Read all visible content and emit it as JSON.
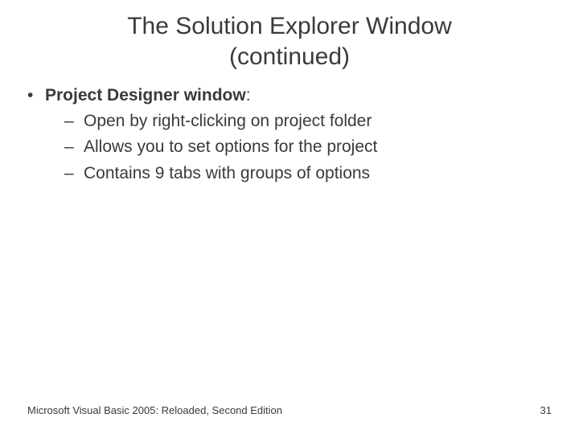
{
  "title_line1": "The Solution Explorer Window",
  "title_line2": "(continued)",
  "bullets": {
    "lead": "Project Designer window",
    "lead_suffix": ":",
    "items": [
      "Open by right-clicking on project folder",
      "Allows you to set options for the project",
      "Contains 9 tabs with groups of options"
    ]
  },
  "footer": {
    "left": "Microsoft Visual Basic 2005: Reloaded, Second Edition",
    "right": "31"
  }
}
